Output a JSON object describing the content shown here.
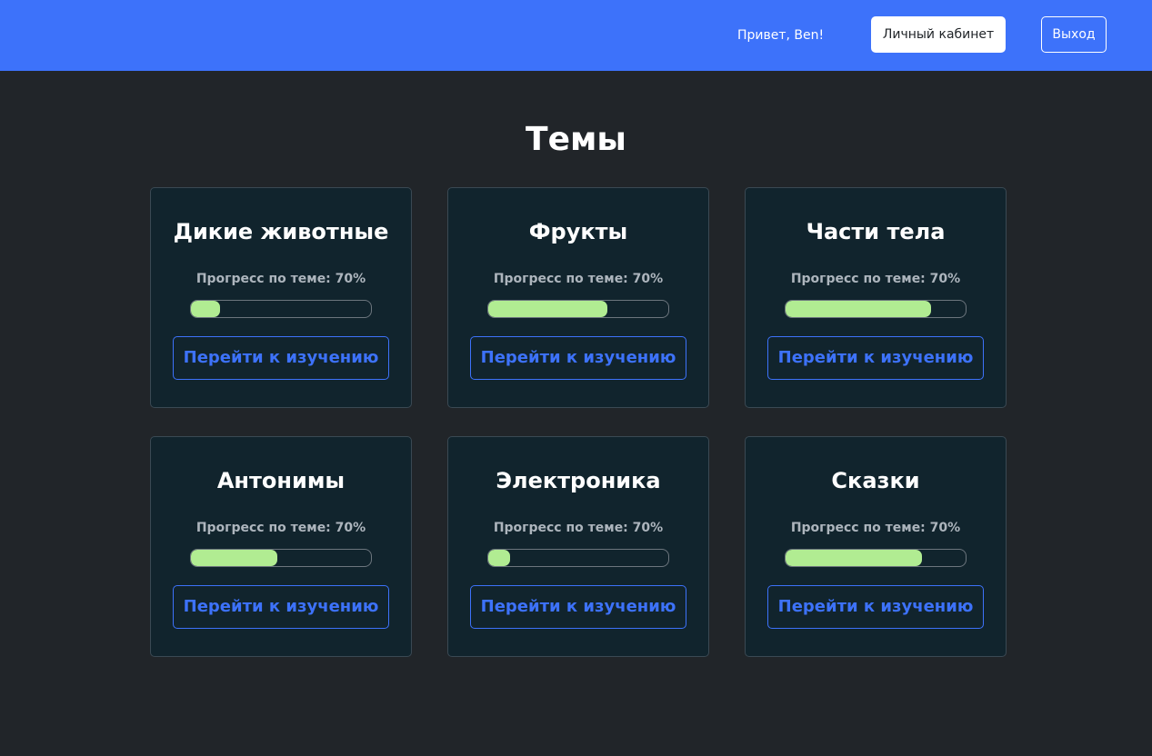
{
  "header": {
    "greeting": "Привет, Ben!",
    "cabinet_label": "Личный кабинет",
    "exit_label": "Выход"
  },
  "page": {
    "title": "Темы"
  },
  "topics": [
    {
      "title": "Дикие животные",
      "progress_label": "Прогресс по теме: 70%",
      "progress_fill": 0.16,
      "button_label": "Перейти к изучению"
    },
    {
      "title": "Фрукты",
      "progress_label": "Прогресс по теме: 70%",
      "progress_fill": 0.66,
      "button_label": "Перейти к изучению"
    },
    {
      "title": "Части тела",
      "progress_label": "Прогресс по теме: 70%",
      "progress_fill": 0.81,
      "button_label": "Перейти к изучению"
    },
    {
      "title": "Антонимы",
      "progress_label": "Прогресс по теме: 70%",
      "progress_fill": 0.48,
      "button_label": "Перейти к изучению"
    },
    {
      "title": "Электроника",
      "progress_label": "Прогресс по теме: 70%",
      "progress_fill": 0.12,
      "button_label": "Перейти к изучению"
    },
    {
      "title": "Сказки",
      "progress_label": "Прогресс по теме: 70%",
      "progress_fill": 0.76,
      "button_label": "Перейти к изучению"
    }
  ],
  "colors": {
    "header_bg": "#3d72fa",
    "page_bg": "#212529",
    "card_bg": "#11242d",
    "accent": "#3d72fa",
    "progress": "#b1ec92"
  }
}
